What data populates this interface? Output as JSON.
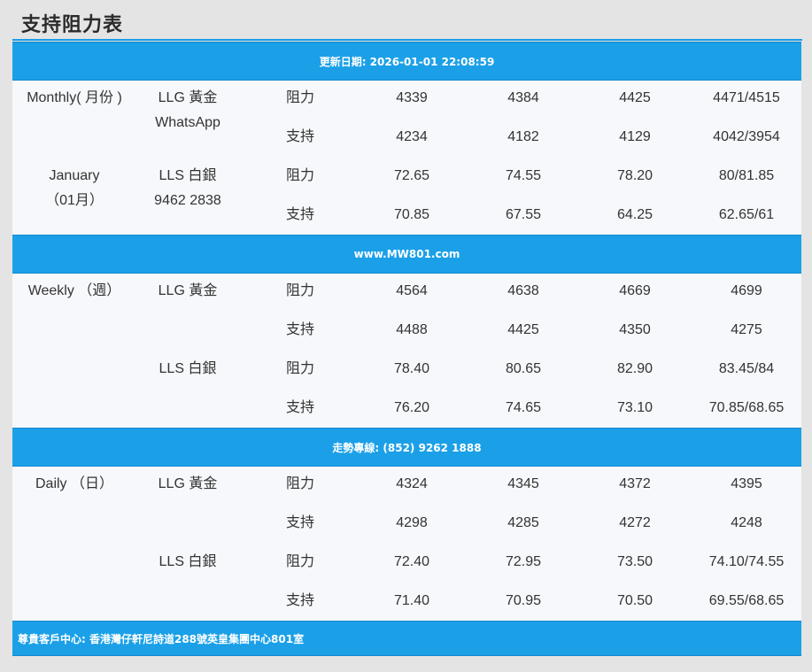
{
  "page_title": "支持阻力表",
  "bars": {
    "update": "更新日期: 2026-01-01 22:08:59",
    "website": "www.MW801.com",
    "hotline": "走勢專線: (852) 9262 1888",
    "address": "尊貴客戶中心: 香港灣仔軒尼詩道288號英皇集團中心801室"
  },
  "sections": {
    "monthly": {
      "label_line1": "Monthly( 月份 )",
      "label_line2": "January",
      "label_line3": "（01月）",
      "group1_line1": "LLG 黃金",
      "group1_line2": "WhatsApp",
      "group2_line1": "LLS 白銀",
      "group2_line2": "9462 2838",
      "rows": [
        {
          "type": "阻力",
          "values": [
            "4339",
            "4384",
            "4425",
            "4471/4515"
          ]
        },
        {
          "type": "支持",
          "values": [
            "4234",
            "4182",
            "4129",
            "4042/3954"
          ]
        },
        {
          "type": "阻力",
          "values": [
            "72.65",
            "74.55",
            "78.20",
            "80/81.85"
          ]
        },
        {
          "type": "支持",
          "values": [
            "70.85",
            "67.55",
            "64.25",
            "62.65/61"
          ]
        }
      ]
    },
    "weekly": {
      "label_line1": "Weekly （週）",
      "group1_line1": "LLG 黃金",
      "group2_line1": "LLS 白銀",
      "rows": [
        {
          "type": "阻力",
          "values": [
            "4564",
            "4638",
            "4669",
            "4699"
          ]
        },
        {
          "type": "支持",
          "values": [
            "4488",
            "4425",
            "4350",
            "4275"
          ]
        },
        {
          "type": "阻力",
          "values": [
            "78.40",
            "80.65",
            "82.90",
            "83.45/84"
          ]
        },
        {
          "type": "支持",
          "values": [
            "76.20",
            "74.65",
            "73.10",
            "70.85/68.65"
          ]
        }
      ]
    },
    "daily": {
      "label_line1": "Daily （日）",
      "group1_line1": "LLG 黃金",
      "group2_line1": "LLS 白銀",
      "rows": [
        {
          "type": "阻力",
          "values": [
            "4324",
            "4345",
            "4372",
            "4395"
          ]
        },
        {
          "type": "支持",
          "values": [
            "4298",
            "4285",
            "4272",
            "4248"
          ]
        },
        {
          "type": "阻力",
          "values": [
            "72.40",
            "72.95",
            "73.50",
            "74.10/74.55"
          ]
        },
        {
          "type": "支持",
          "values": [
            "71.40",
            "70.95",
            "70.50",
            "69.55/68.65"
          ]
        }
      ]
    }
  },
  "colors": {
    "accent_bar": "#1ba0e8",
    "panel_bg": "#f7f8fb",
    "page_bg": "#e4e4e4"
  }
}
